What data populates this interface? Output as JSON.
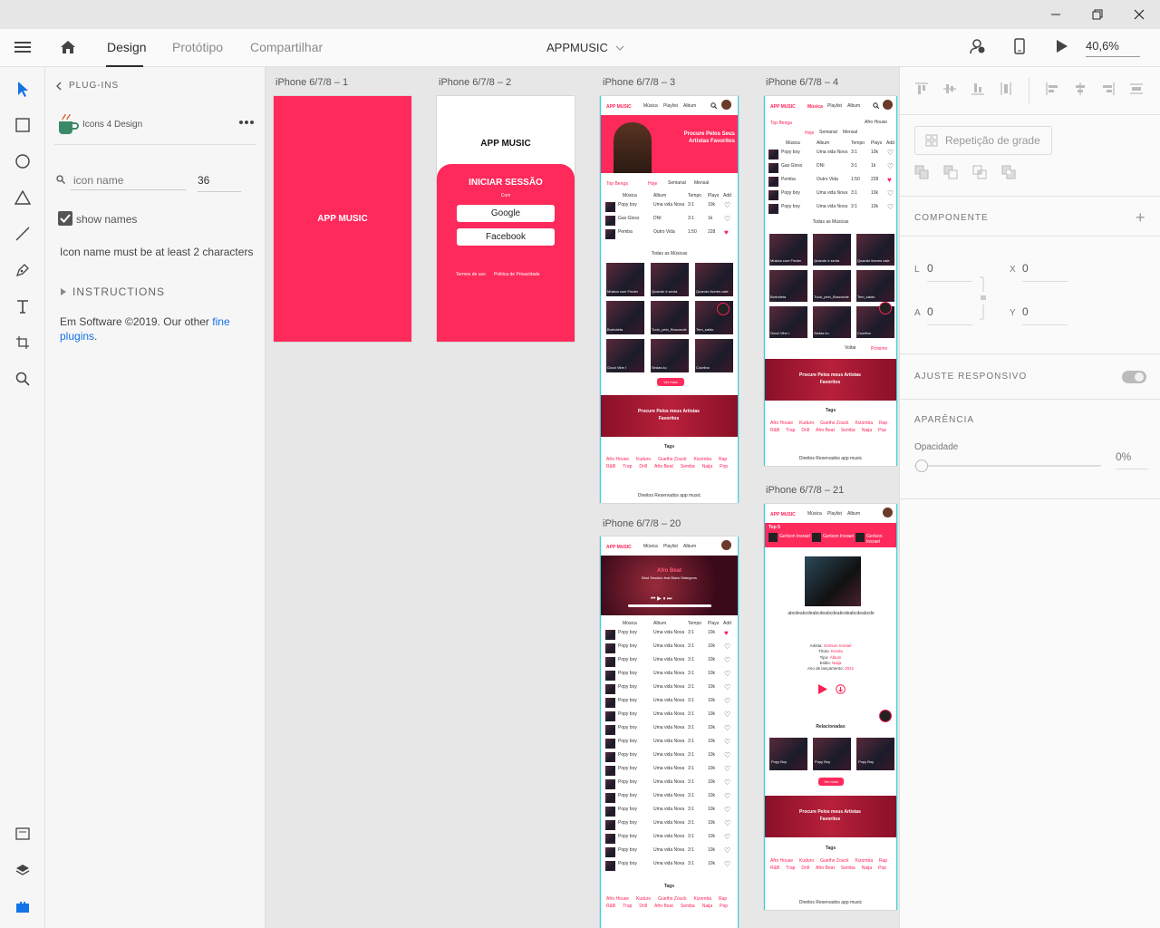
{
  "window": {
    "controls": [
      "minimize",
      "restore",
      "close"
    ]
  },
  "topbar": {
    "tabs": [
      "Design",
      "Protótipo",
      "Compartilhar"
    ],
    "doc_title": "APPMUSIC",
    "zoom": "40,6%"
  },
  "plugins": {
    "back_label": "PLUG-INS",
    "plugin_name": "Icons 4 Design",
    "search_placeholder": "icon name",
    "size_value": "36",
    "show_names_label": "show names",
    "show_names_checked": true,
    "warning": "Icon name must be at least 2 characters",
    "instructions_label": "INSTRUCTIONS",
    "footer_text": "Em Software ©2019. Our other ",
    "footer_link": "fine plugins",
    "footer_end": "."
  },
  "artboards": {
    "a1": {
      "label": "iPhone 6/7/8 – 1",
      "title": "APP MUSIC"
    },
    "a2": {
      "label": "iPhone 6/7/8 – 2",
      "title": "APP MUSIC",
      "login_title": "INICIAR SESSÃO",
      "with": "Com",
      "google": "Google",
      "facebook": "Facebook",
      "terms": "Termos de uso",
      "privacy": "Politica de Privacidade"
    },
    "a3": {
      "label": "iPhone 6/7/8 – 3"
    },
    "a4": {
      "label": "iPhone 6/7/8 – 4"
    },
    "a20": {
      "label": "iPhone 6/7/8 – 20"
    },
    "a21": {
      "label": "iPhone 6/7/8 – 21"
    }
  },
  "mock": {
    "brand": "APP MUSIC",
    "nav": [
      "Música",
      "Playlist",
      "Album"
    ],
    "hero": "Procure Pelos Seus Artistas Favoritos",
    "top_benga": "Top Benga",
    "filters": [
      "Hoje",
      "Semanal",
      "Mensal"
    ],
    "afro_house": "Afro House",
    "cols": [
      "Música",
      "Album",
      "Tempo",
      "Plays",
      "Add"
    ],
    "songs": [
      {
        "t": "Popy boy",
        "a": "Uma vida Nova",
        "d": "3:1",
        "p": "10k",
        "fav": false
      },
      {
        "t": "Gas Gloss",
        "a": "DNI",
        "d": "3:1",
        "p": "1k",
        "fav": false
      },
      {
        "t": "Pemba",
        "a": "Outro Vida",
        "d": "1:50",
        "p": "228",
        "fav": true
      },
      {
        "t": "Popy boy",
        "a": "Uma vida Nova",
        "d": "3:1",
        "p": "10k",
        "fav": false
      },
      {
        "t": "Popy boy",
        "a": "Uma vida Nova",
        "d": "3:1",
        "p": "10k",
        "fav": false
      }
    ],
    "all_songs": "Todas as Músicas",
    "tiles": [
      "Música com Fínder",
      "Quando é sexta",
      "Quando tiveres vale",
      "Borboleta",
      "Tudo_pelo_Bosconde",
      "Tem_saldo",
      "Good Vibe I",
      "Sedas ku",
      "Coorlino"
    ],
    "see_more": "Ver mais",
    "back": "Voltar",
    "next": "Próximo",
    "banner": "Procure Pelos meus Artistas Favoritos",
    "tags_title": "Tags",
    "tags": [
      "Afro House",
      "Kuduro",
      "Guetho Zouck",
      "Kizomba",
      "Rap",
      "R&B",
      "Trap",
      "Drill",
      "Afro Beat",
      "Semba",
      "Naija",
      "Pop"
    ],
    "copyright": "Direitos Reservados app music",
    "player_title": "Afro Beat",
    "player_sub": "Best Session feat Black Waleguns",
    "top5": "Top 5",
    "artist": "Gerlson Insrael",
    "lorem": "abcdeabcdeabcdeabcdeabcdeabcdeabcde",
    "detail": [
      [
        "Artista:",
        "Gerlson Insrael"
      ],
      [
        "Título:",
        "Evaria"
      ],
      [
        "Tipo:",
        "Álbum"
      ],
      [
        "Estilo:",
        "Naija"
      ],
      [
        "Ano de lançamento:",
        "2021"
      ]
    ],
    "related": "Relacionadas",
    "related_items": [
      "Popy Boy",
      "Popy Boy",
      "Popy Boy"
    ]
  },
  "right": {
    "repeat_grid": "Repetição de grade",
    "component": "COMPONENTE",
    "L": "0",
    "X": "0",
    "A": "0",
    "Y": "0",
    "labels": {
      "L": "L",
      "X": "X",
      "A": "A",
      "Y": "Y"
    },
    "responsive": "AJUSTE RESPONSIVO",
    "appearance": "APARÊNCIA",
    "opacity_label": "Opacidade",
    "opacity": "0%"
  },
  "colors": {
    "accent": "#fd2a5b",
    "guide": "#2ad7e6",
    "xd_blue": "#1473e6"
  }
}
